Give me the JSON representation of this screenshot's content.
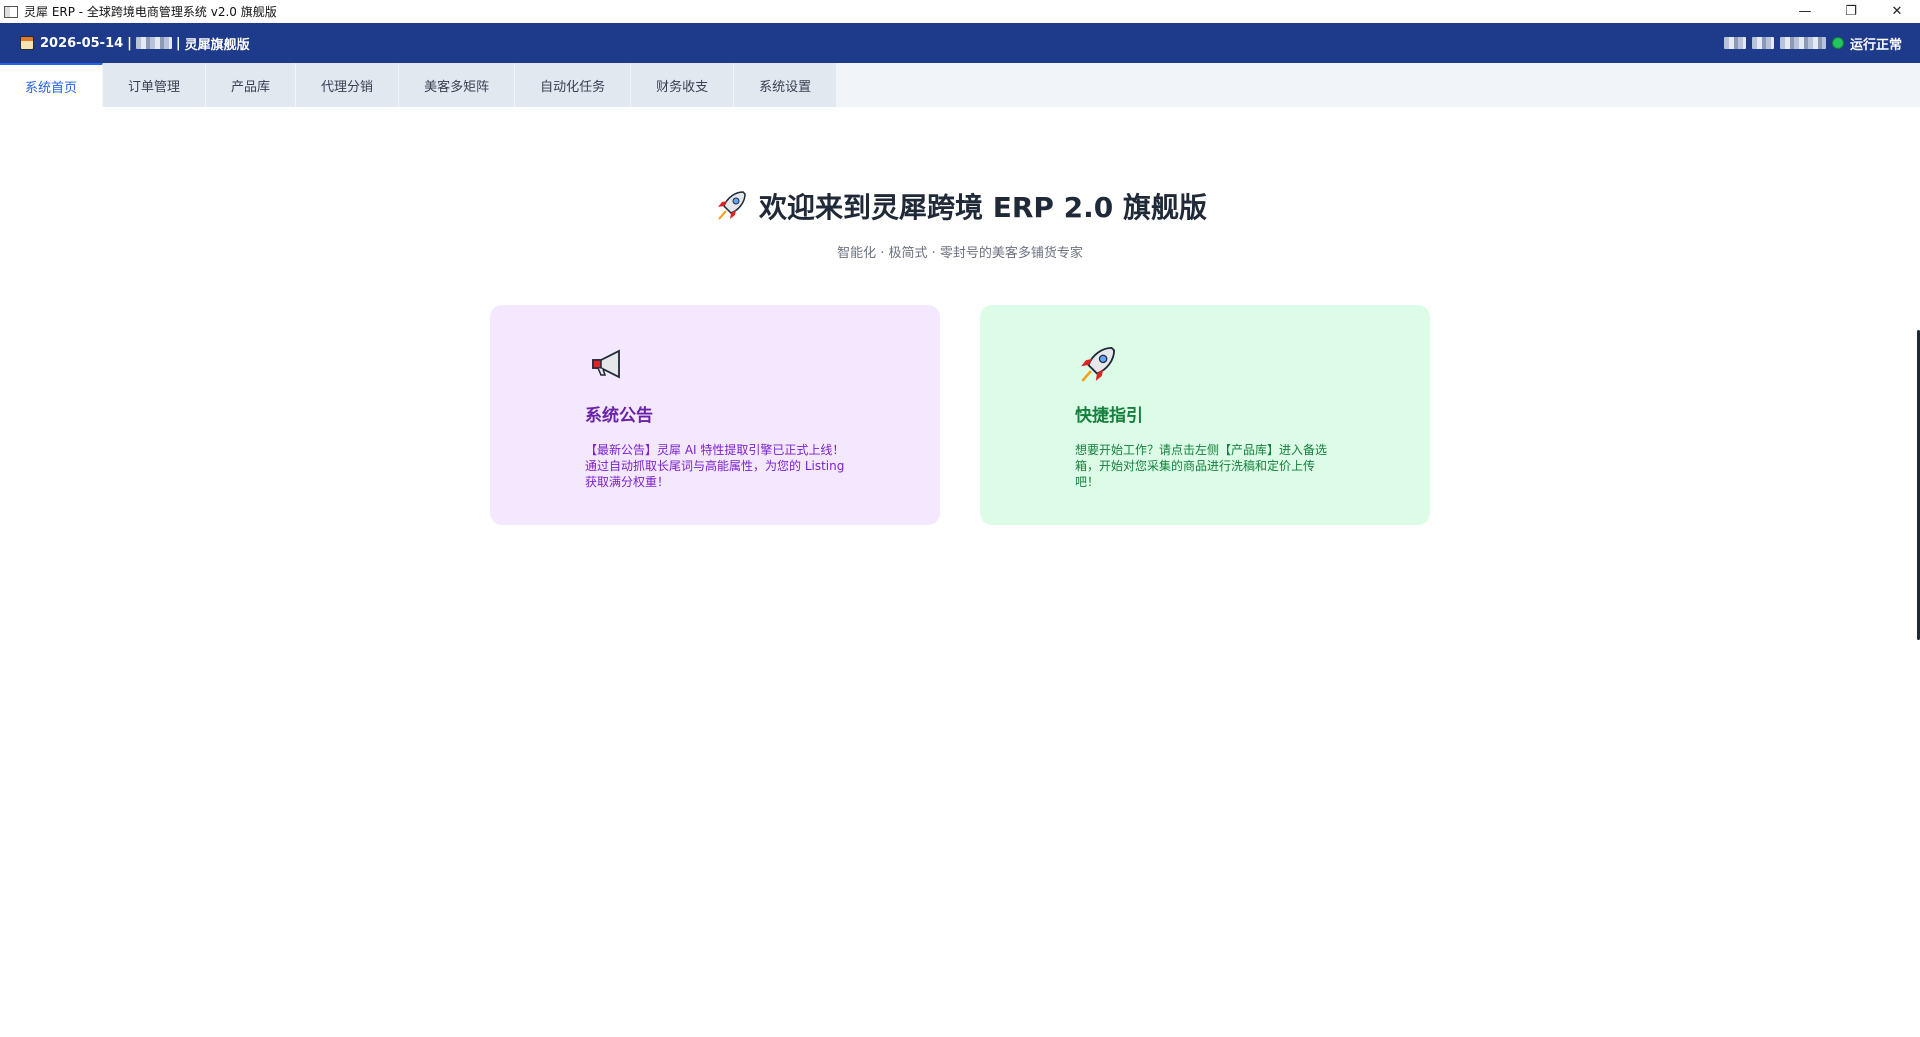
{
  "window": {
    "title": "灵犀 ERP - 全球跨境电商管理系统 v2.0 旗舰版",
    "minimize_glyph": "—",
    "restore_glyph": "❐",
    "close_glyph": "✕"
  },
  "status": {
    "date": "2026-05-14",
    "separator": "|",
    "edition": "灵犀旗舰版",
    "run_status": "运行正常",
    "colors": {
      "bar": "#1e3a8a",
      "ok": "#22c55e"
    }
  },
  "tabs": [
    {
      "label": "系统首页",
      "active": true
    },
    {
      "label": "订单管理",
      "active": false
    },
    {
      "label": "产品库",
      "active": false
    },
    {
      "label": "代理分销",
      "active": false
    },
    {
      "label": "美客多矩阵",
      "active": false
    },
    {
      "label": "自动化任务",
      "active": false
    },
    {
      "label": "财务收支",
      "active": false
    },
    {
      "label": "系统设置",
      "active": false
    }
  ],
  "hero": {
    "title": "欢迎来到灵犀跨境 ERP 2.0 旗舰版",
    "subtitle": "智能化 · 极简式 · 零封号的美客多铺货专家",
    "icon": "rocket-icon"
  },
  "cards": {
    "notice": {
      "icon": "megaphone-icon",
      "title": "系统公告",
      "text": "【最新公告】灵犀 AI 特性提取引擎已正式上线！通过自动抓取长尾词与高能属性，为您的 Listing 获取满分权重！"
    },
    "guide": {
      "icon": "rocket-icon",
      "title": "快捷指引",
      "text": "想要开始工作？请点击左侧【产品库】进入备选箱，开始对您采集的商品进行洗稿和定价上传吧！"
    }
  }
}
